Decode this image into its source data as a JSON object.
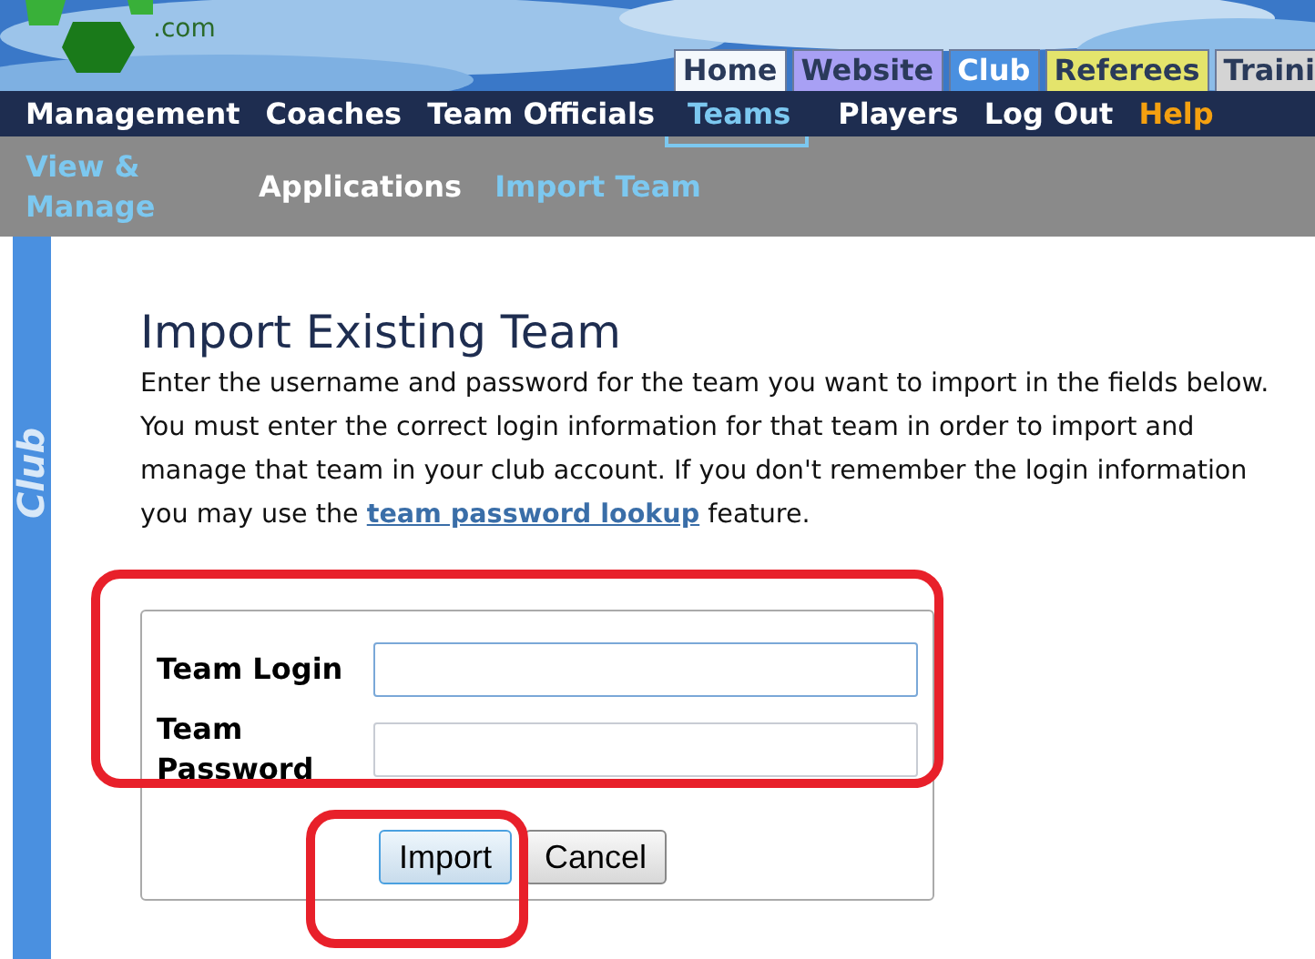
{
  "logo": {
    "domain": ".com"
  },
  "site_tabs": [
    {
      "label": "Home",
      "color": "#f4f8fc",
      "selected": false
    },
    {
      "label": "Website",
      "color": "#a8a0f4",
      "selected": false
    },
    {
      "label": "Club",
      "color": "#4a90e0",
      "selected": true
    },
    {
      "label": "Referees",
      "color": "#e4e46c",
      "selected": false
    },
    {
      "label": "Traini",
      "color": "#d4d4d4",
      "selected": false
    }
  ],
  "main_nav": [
    {
      "label": "Management",
      "color": "#ffffff",
      "selected": false
    },
    {
      "label": "Coaches",
      "color": "#ffffff",
      "selected": false
    },
    {
      "label": "Team Officials",
      "color": "#ffffff",
      "selected": false
    },
    {
      "label": "Teams",
      "color": "#7cc8f0",
      "selected": true
    },
    {
      "label": "Players",
      "color": "#ffffff",
      "selected": false
    },
    {
      "label": "Log Out",
      "color": "#ffffff",
      "selected": false
    },
    {
      "label": "Help",
      "color": "#f4a010",
      "selected": false
    }
  ],
  "sub_nav": [
    {
      "label": "View & Manage",
      "color": "#7cc8f0"
    },
    {
      "label": "Applications",
      "color": "#ffffff"
    },
    {
      "label": "Import Team",
      "color": "#7cc8f0"
    }
  ],
  "side_tab": {
    "label": "Club"
  },
  "heading": "Import Existing Team",
  "intro": "Enter the username and password for the team you want to import in the fields below. You must enter the correct login information for that team in order to import and manage that team in your club account. If you don't remember the login information you may use the",
  "intro_link": "team password lookup",
  "intro_end": "feature.",
  "form": {
    "fields": [
      {
        "label": "Team Login",
        "focused": true
      },
      {
        "label": "Team Password",
        "focused": false
      }
    ],
    "buttons": [
      {
        "label": "Import",
        "focused": true
      },
      {
        "label": "Cancel",
        "focused": false
      }
    ]
  }
}
